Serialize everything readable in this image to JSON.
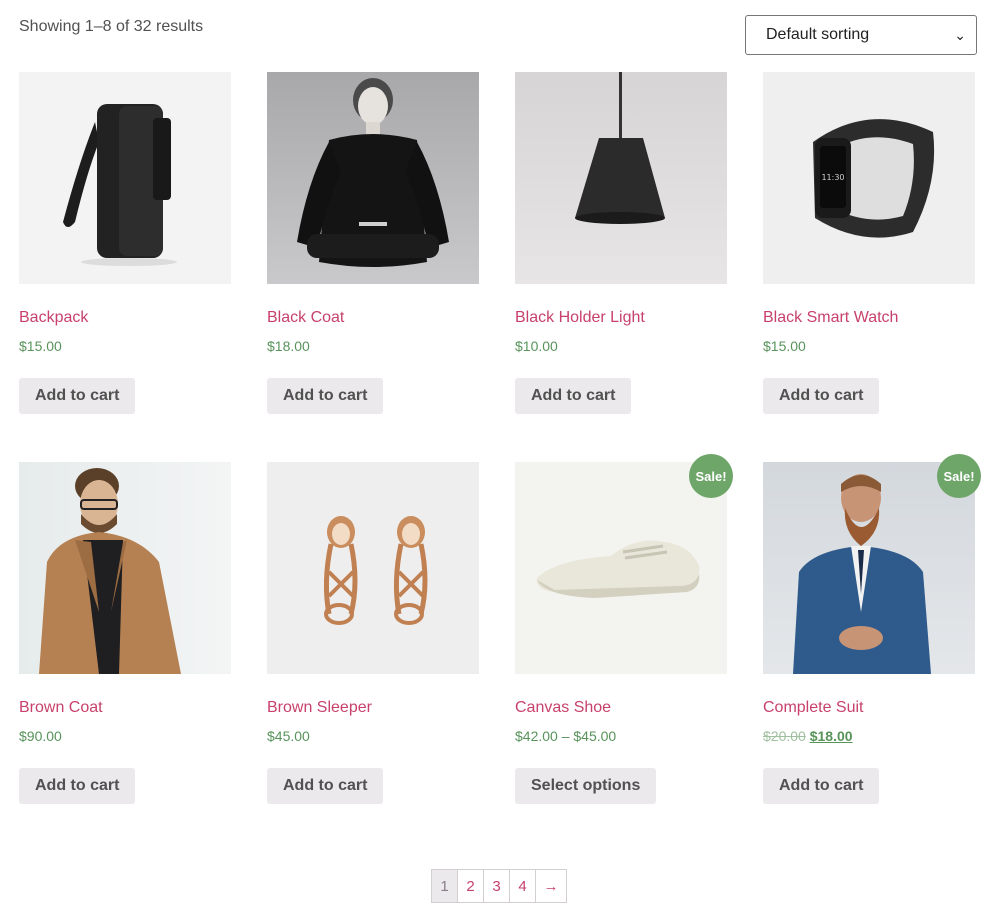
{
  "result_count": "Showing 1–8 of 32 results",
  "sorting": {
    "selected": "Default sorting"
  },
  "colors": {
    "accent": "#c7416c",
    "price": "#58935a",
    "sale_badge": "#6ea569",
    "button_bg": "#ebe9eb"
  },
  "products": [
    {
      "name": "Backpack",
      "price": "$15.00",
      "button": "Add to cart",
      "image_icon": "backpack-image"
    },
    {
      "name": "Black Coat",
      "price": "$18.00",
      "button": "Add to cart",
      "image_icon": "woman-black-coat-image"
    },
    {
      "name": "Black Holder Light",
      "price": "$10.00",
      "button": "Add to cart",
      "image_icon": "pendant-lamp-image"
    },
    {
      "name": "Black Smart Watch",
      "price": "$15.00",
      "button": "Add to cart",
      "image_icon": "smart-watch-image"
    },
    {
      "name": "Brown Coat",
      "price": "$90.00",
      "button": "Add to cart",
      "image_icon": "man-brown-coat-image"
    },
    {
      "name": "Brown Sleeper",
      "price": "$45.00",
      "button": "Add to cart",
      "image_icon": "sandals-image"
    },
    {
      "name": "Canvas Shoe",
      "price": "$42.00 – $45.00",
      "button": "Select options",
      "sale_badge": "Sale!",
      "image_icon": "canvas-shoe-image"
    },
    {
      "name": "Complete Suit",
      "price_old": "$20.00",
      "price_new": "$18.00",
      "button": "Add to cart",
      "sale_badge": "Sale!",
      "image_icon": "man-suit-image"
    }
  ],
  "pagination": {
    "pages": [
      "1",
      "2",
      "3",
      "4"
    ],
    "next": "→",
    "current": "1"
  }
}
